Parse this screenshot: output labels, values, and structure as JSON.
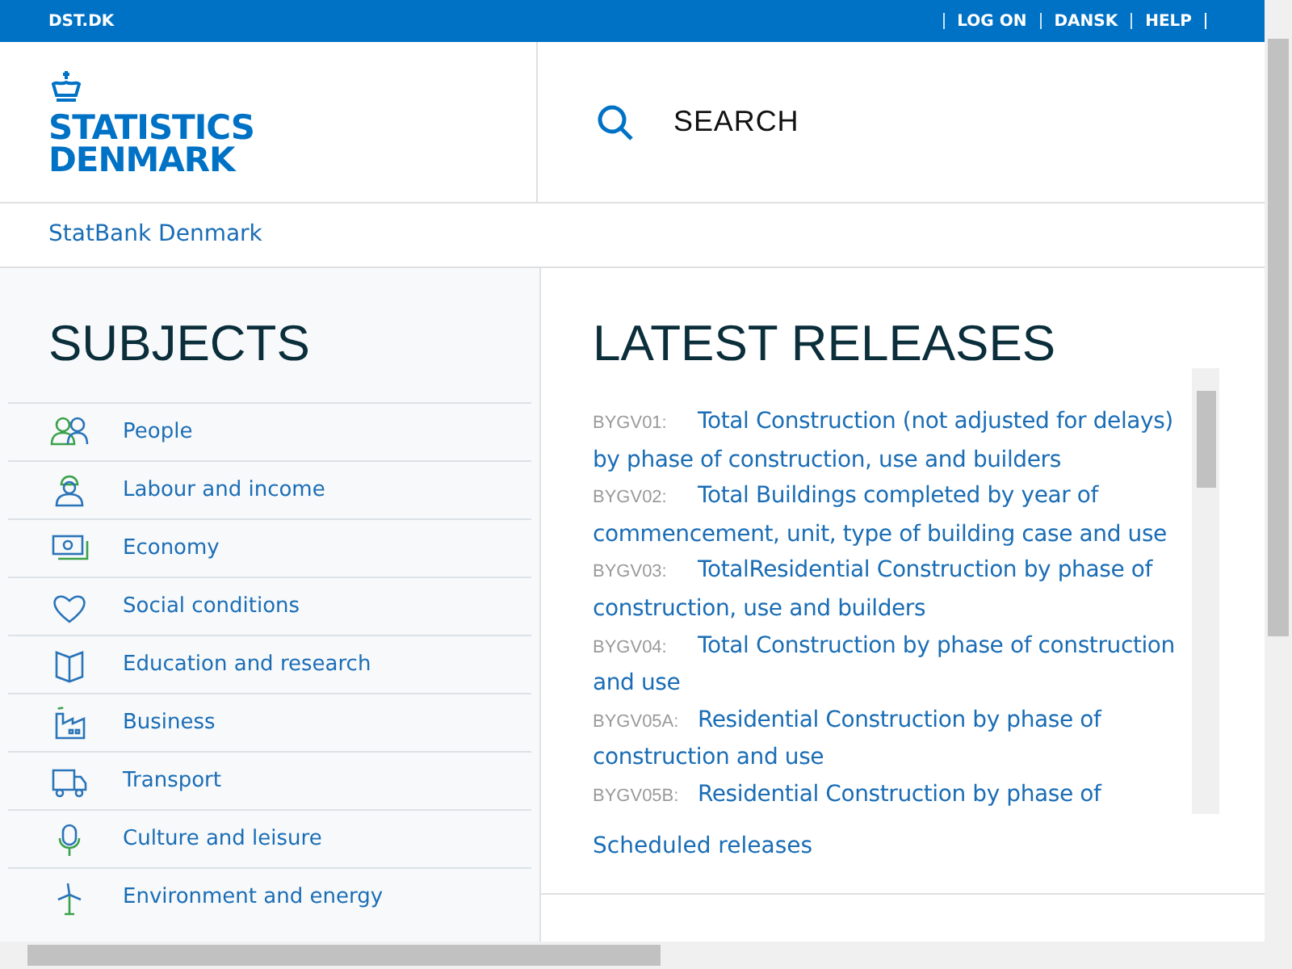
{
  "top_bar": {
    "site": "DST.DK",
    "links": [
      "LOG ON",
      "DANSK",
      "HELP"
    ]
  },
  "header": {
    "logo_lines": [
      "STATISTICS",
      "DENMARK"
    ],
    "search": "SEARCH"
  },
  "breadcrumb": "StatBank Denmark",
  "subjects": {
    "title": "SUBJECTS",
    "items": [
      {
        "label": "People",
        "kind": "people"
      },
      {
        "label": "Labour and income",
        "kind": "worker"
      },
      {
        "label": "Economy",
        "kind": "money"
      },
      {
        "label": "Social conditions",
        "kind": "heart"
      },
      {
        "label": "Education and research",
        "kind": "book"
      },
      {
        "label": "Business",
        "kind": "factory"
      },
      {
        "label": "Transport",
        "kind": "truck"
      },
      {
        "label": "Culture and leisure",
        "kind": "microphone"
      },
      {
        "label": "Environment and energy",
        "kind": "windmill"
      }
    ]
  },
  "releases": {
    "title": "LATEST RELEASES",
    "items": [
      {
        "code": "BYGV01:",
        "title": "Total Construction (not adjusted for delays) by phase of construction, use and builders"
      },
      {
        "code": "BYGV02:",
        "title": "Total Buildings completed by year of commencement, unit, type of building case and use"
      },
      {
        "code": "BYGV03:",
        "title": "TotalResidential Construction by phase of construction, use and builders"
      },
      {
        "code": "BYGV04:",
        "title": "Total Construction by phase of construction and use"
      },
      {
        "code": "BYGV05A:",
        "title": "Residential Construction by phase of construction and use"
      },
      {
        "code": "BYGV05B:",
        "title": "Residential Construction by phase of"
      }
    ],
    "link": "Scheduled releases"
  }
}
